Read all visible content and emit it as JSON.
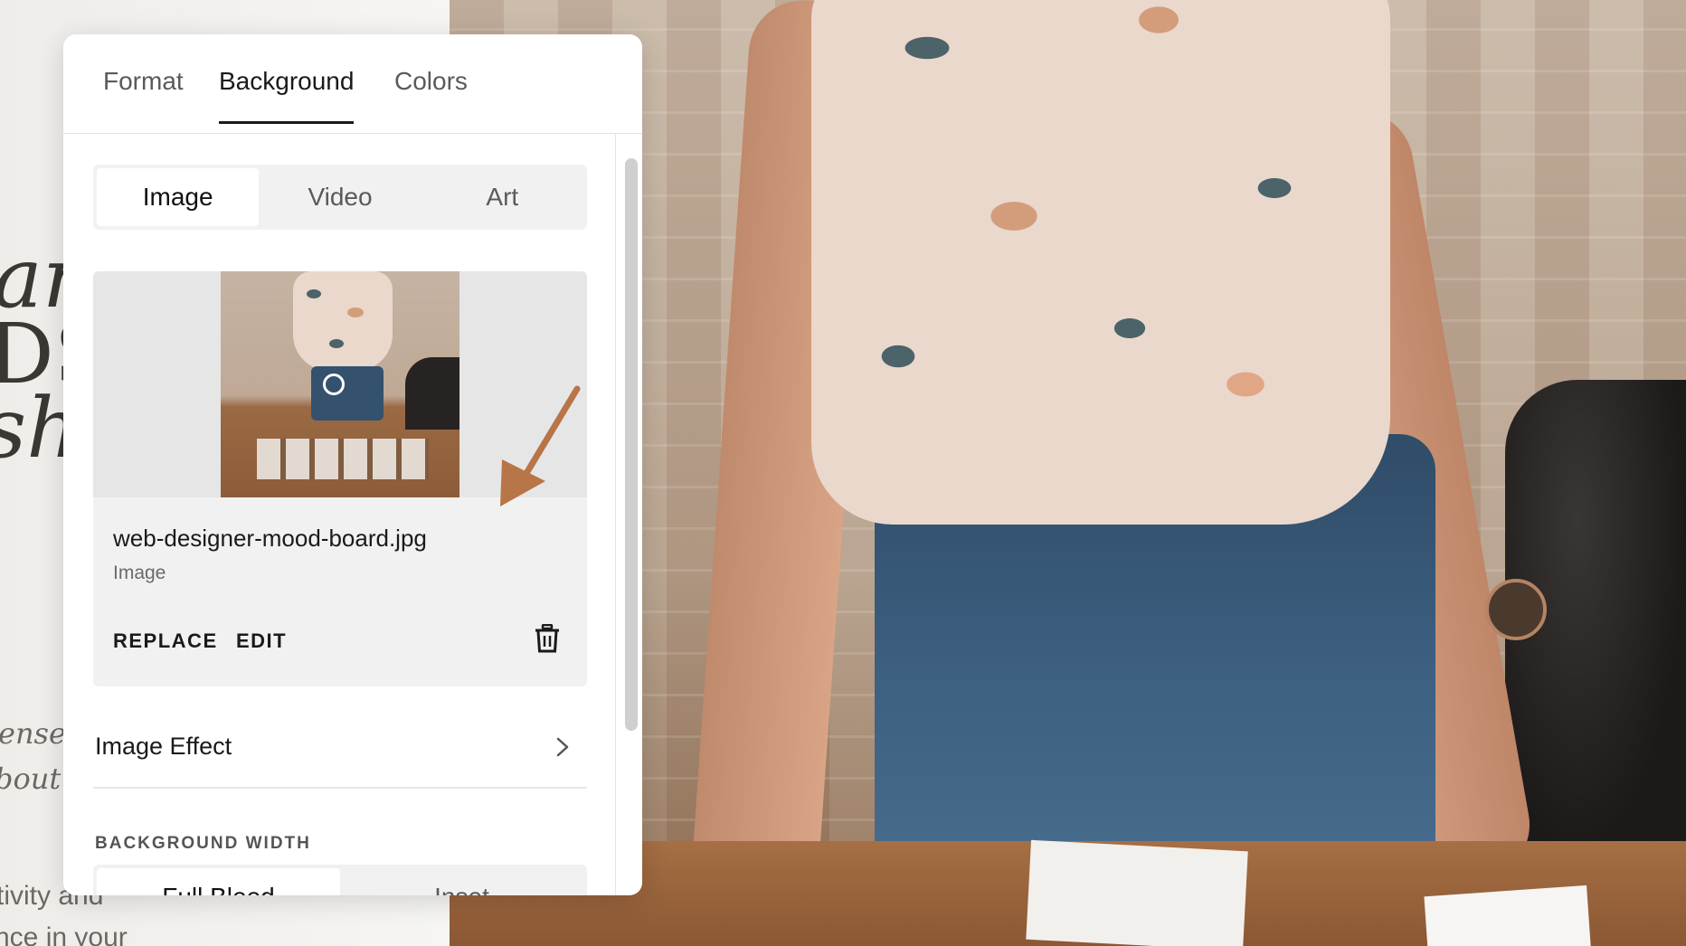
{
  "site": {
    "fragments": {
      "heading_line1": "art",
      "heading_line2": "DS",
      "heading_line3": "sh",
      "body_line1": "ense",
      "body_line2": "bout r",
      "body_line3": "tivity and",
      "body_line4": "nce in your"
    }
  },
  "panel": {
    "tabs": [
      "Format",
      "Background",
      "Colors"
    ],
    "active_tab": "Background",
    "media_type": {
      "options": [
        "Image",
        "Video",
        "Art"
      ],
      "selected": "Image"
    },
    "media": {
      "file_name": "web-designer-mood-board.jpg",
      "file_type": "Image",
      "replace_label": "REPLACE",
      "edit_label": "EDIT",
      "delete_icon": "trash-icon"
    },
    "image_effect_label": "Image Effect",
    "background_width": {
      "title": "BACKGROUND WIDTH",
      "options": [
        "Full Bleed",
        "Inset"
      ],
      "selected": "Full Bleed"
    }
  },
  "colors": {
    "accent_arrow": "#b87547",
    "active_text": "#1a1a1a",
    "inactive_text": "#5a5a5a"
  }
}
